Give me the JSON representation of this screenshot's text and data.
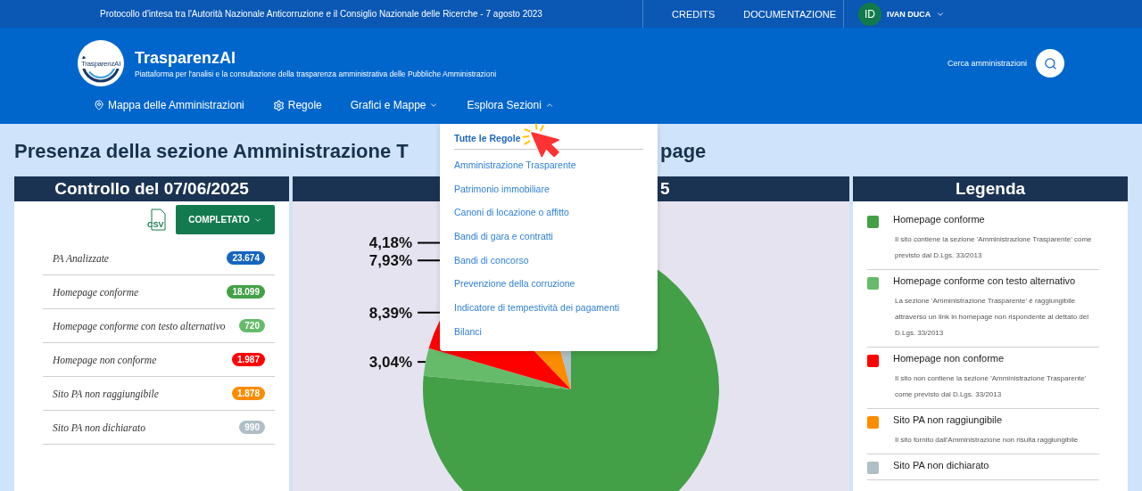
{
  "top_bar": {
    "notice": "Protocollo d'intesa tra l'Autorità Nazionale Anticorruzione e il Consiglio Nazionale delle Ricerche - 7 agosto 2023",
    "links": [
      "CREDITS",
      "DOCUMENTAZIONE"
    ],
    "user": {
      "initials": "ID",
      "name": "IVAN DUCA"
    }
  },
  "header": {
    "logo_text": "TrasparenzAI",
    "title": "TrasparenzAI",
    "subtitle": "Piattaforma per l'analisi e la consultazione della trasparenza amministrativa delle Pubbliche Amministrazioni",
    "search_label": "Cerca amministrazioni"
  },
  "nav": [
    {
      "label": "Mappa delle Amministrazioni",
      "kind": "map"
    },
    {
      "label": "Regole",
      "kind": "settings"
    },
    {
      "label": "Grafici e Mappe",
      "kind": "dropdown",
      "expanded": false
    },
    {
      "label": "Esplora Sezioni",
      "kind": "dropdown",
      "expanded": true
    }
  ],
  "menu": {
    "items": [
      {
        "label": "Tutte le Regole",
        "selected": true
      },
      {
        "label": "Amministrazione Trasparente",
        "selected": false
      },
      {
        "label": "Patrimonio immobiliare",
        "selected": false
      },
      {
        "label": "Canoni di locazione o affitto",
        "selected": false
      },
      {
        "label": "Bandi di gara e contratti",
        "selected": false
      },
      {
        "label": "Bandi di concorso",
        "selected": false
      },
      {
        "label": "Prevenzione della corruzione",
        "selected": false
      },
      {
        "label": "Indicatore di tempestività dei pagamenti",
        "selected": false
      },
      {
        "label": "Bilanci",
        "selected": false
      }
    ]
  },
  "heading": {
    "start": "Presenza della sezione Amministrazione T",
    "end": "page"
  },
  "summary": {
    "title": "Controllo del 07/06/2025",
    "csv_label": "CSV",
    "status_button": "COMPLETATO",
    "rows": [
      {
        "label": "PA Analizzate",
        "count": "23.674",
        "color": "#1565c0"
      },
      {
        "label": "Homepage conforme",
        "count": "18.099",
        "color": "#43a047"
      },
      {
        "label": "Homepage conforme con testo alternativo",
        "count": "720",
        "color": "#66bb6a"
      },
      {
        "label": "Homepage non conforme",
        "count": "1.987",
        "color": "#ff0000"
      },
      {
        "label": "Sito PA non raggiungibile",
        "count": "1.878",
        "color": "#fb8c00"
      },
      {
        "label": "Sito PA non dichiarato",
        "count": "990",
        "color": "#b0bec5"
      }
    ]
  },
  "chart_panel": {
    "title": "5",
    "chart_data": {
      "type": "pie",
      "values": [
        76.45,
        3.04,
        8.39,
        7.93,
        4.18
      ],
      "value_labels": [
        null,
        "3,04%",
        "8,39%",
        "7,93%",
        "4,18%"
      ]
    }
  },
  "legend": {
    "title": "Legenda",
    "items": [
      {
        "title": "Homepage conforme",
        "description": "Il sito contiene la sezione 'Amministrazione Trasparente' come previsto dal D.Lgs. 33/2013",
        "color": "#43a047"
      },
      {
        "title": "Homepage conforme con testo alternativo",
        "description": "La sezione 'Amministrazione Trasparente' è raggiungibile attraverso un link in homepage non rispondente al dettato del D.Lgs. 33/2013",
        "color": "#66bb6a"
      },
      {
        "title": "Homepage non conforme",
        "description": "Il sito non contiene la sezione 'Amministrazione Trasparente' come previsto dal D.Lgs. 33/2013",
        "color": "#ff0000"
      },
      {
        "title": "Sito PA non raggiungibile",
        "description": "Il sito fornito dall'Amministrazione non risulta raggiungibile",
        "color": "#fb8c00"
      },
      {
        "title": "Sito PA non dichiarato",
        "color": "#b0bec5"
      }
    ]
  }
}
